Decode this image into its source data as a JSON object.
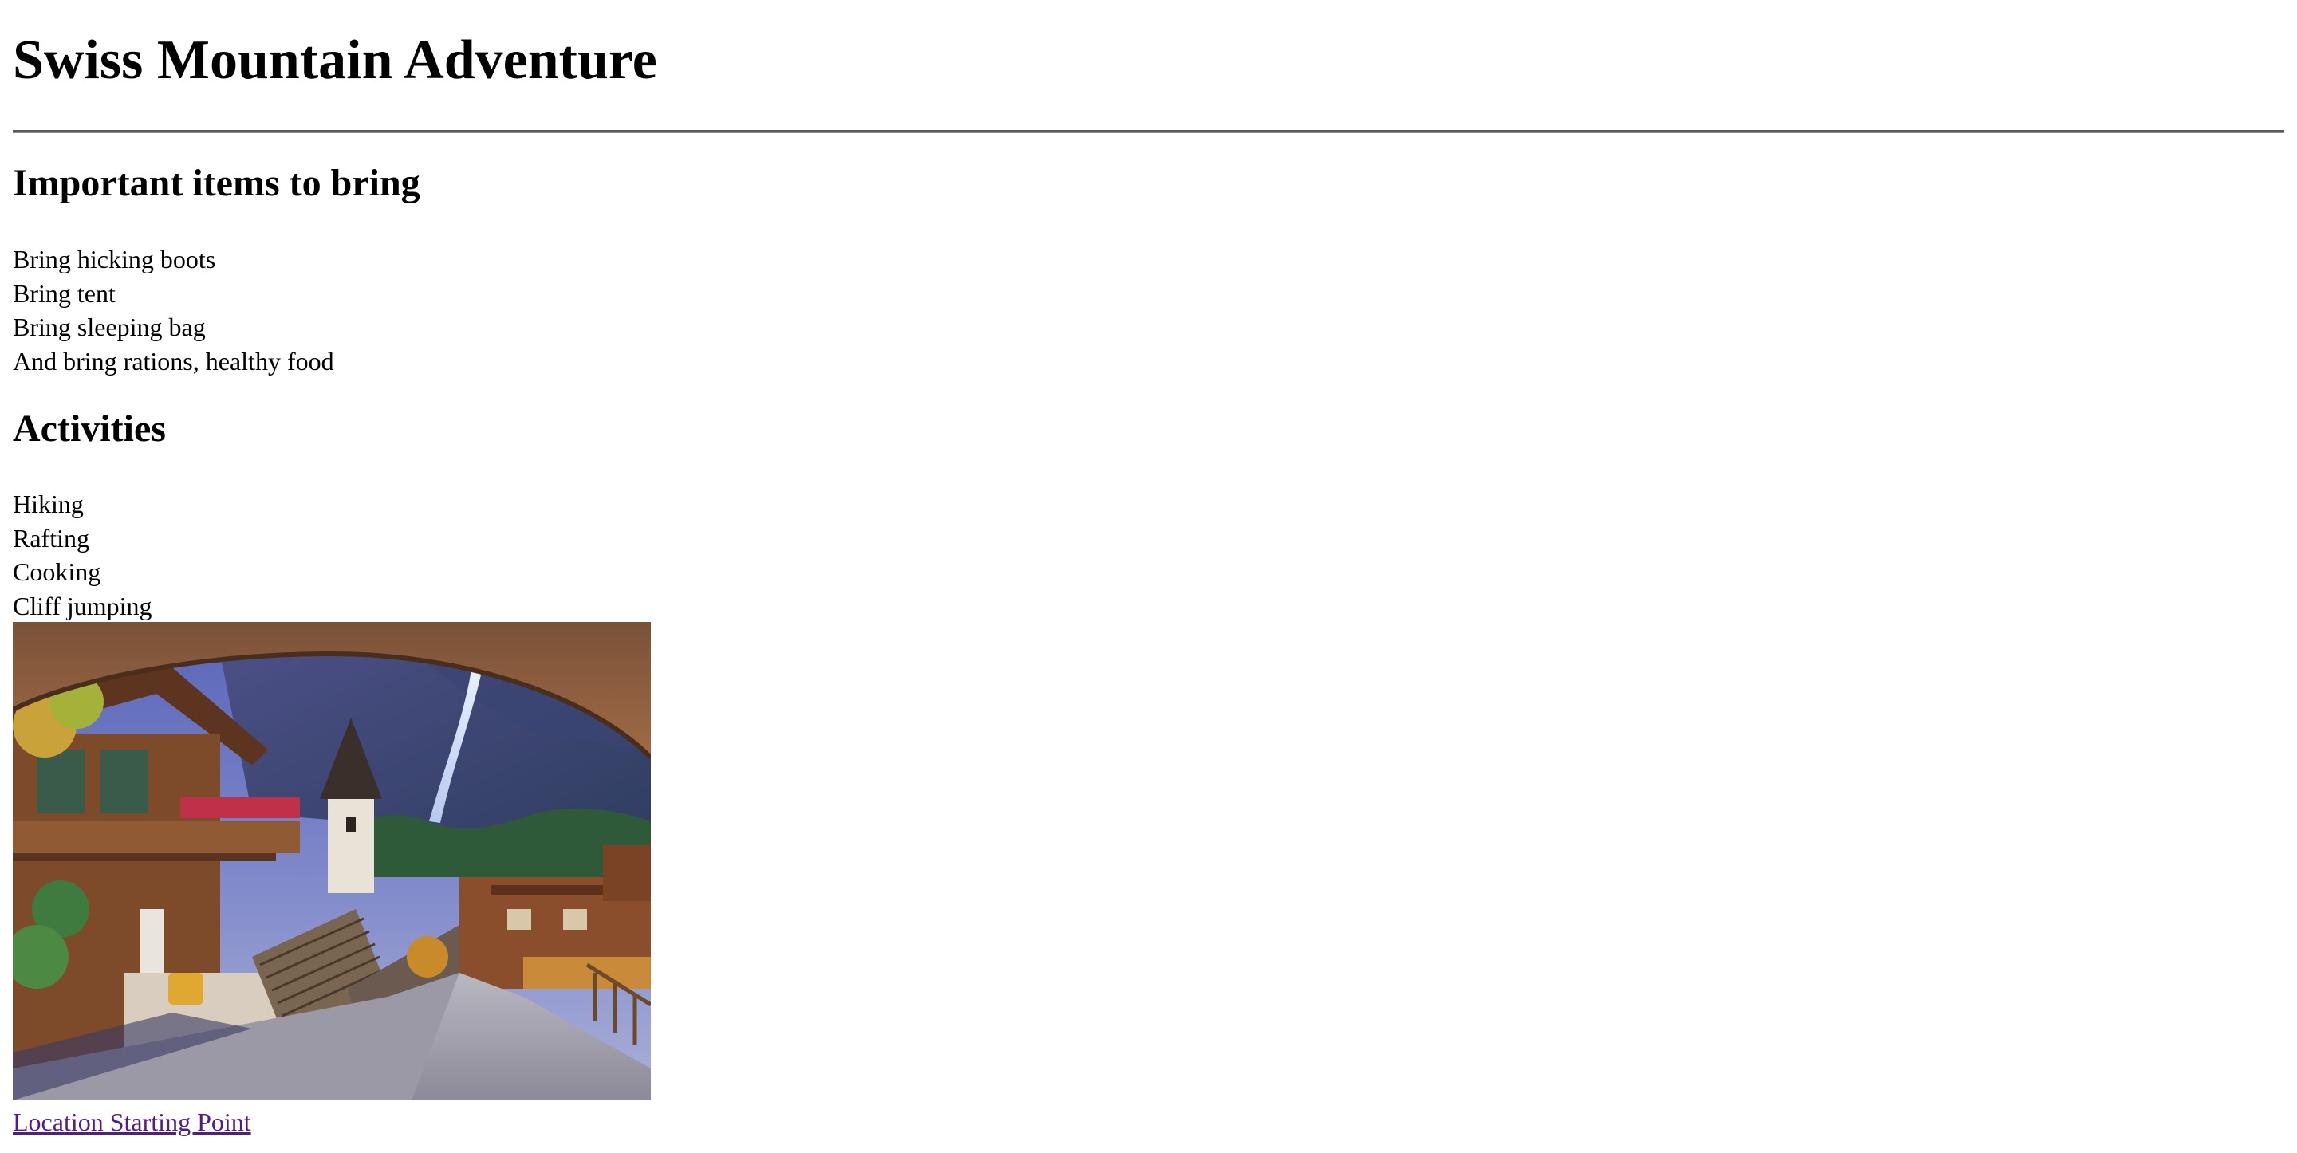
{
  "page": {
    "title": "Swiss Mountain Adventure"
  },
  "items_section": {
    "heading": "Important items to bring",
    "items": [
      "Bring hicking boots",
      "Bring tent",
      "Bring sleeping bag",
      "And bring rations, healthy food"
    ]
  },
  "activities_section": {
    "heading": "Activities",
    "items": [
      "Hiking",
      "Rafting",
      "Cooking",
      "Cliff jumping"
    ]
  },
  "photo": {
    "icon": "village-photo"
  },
  "link": {
    "label": "Location Starting Point",
    "color": "#551a8b"
  }
}
